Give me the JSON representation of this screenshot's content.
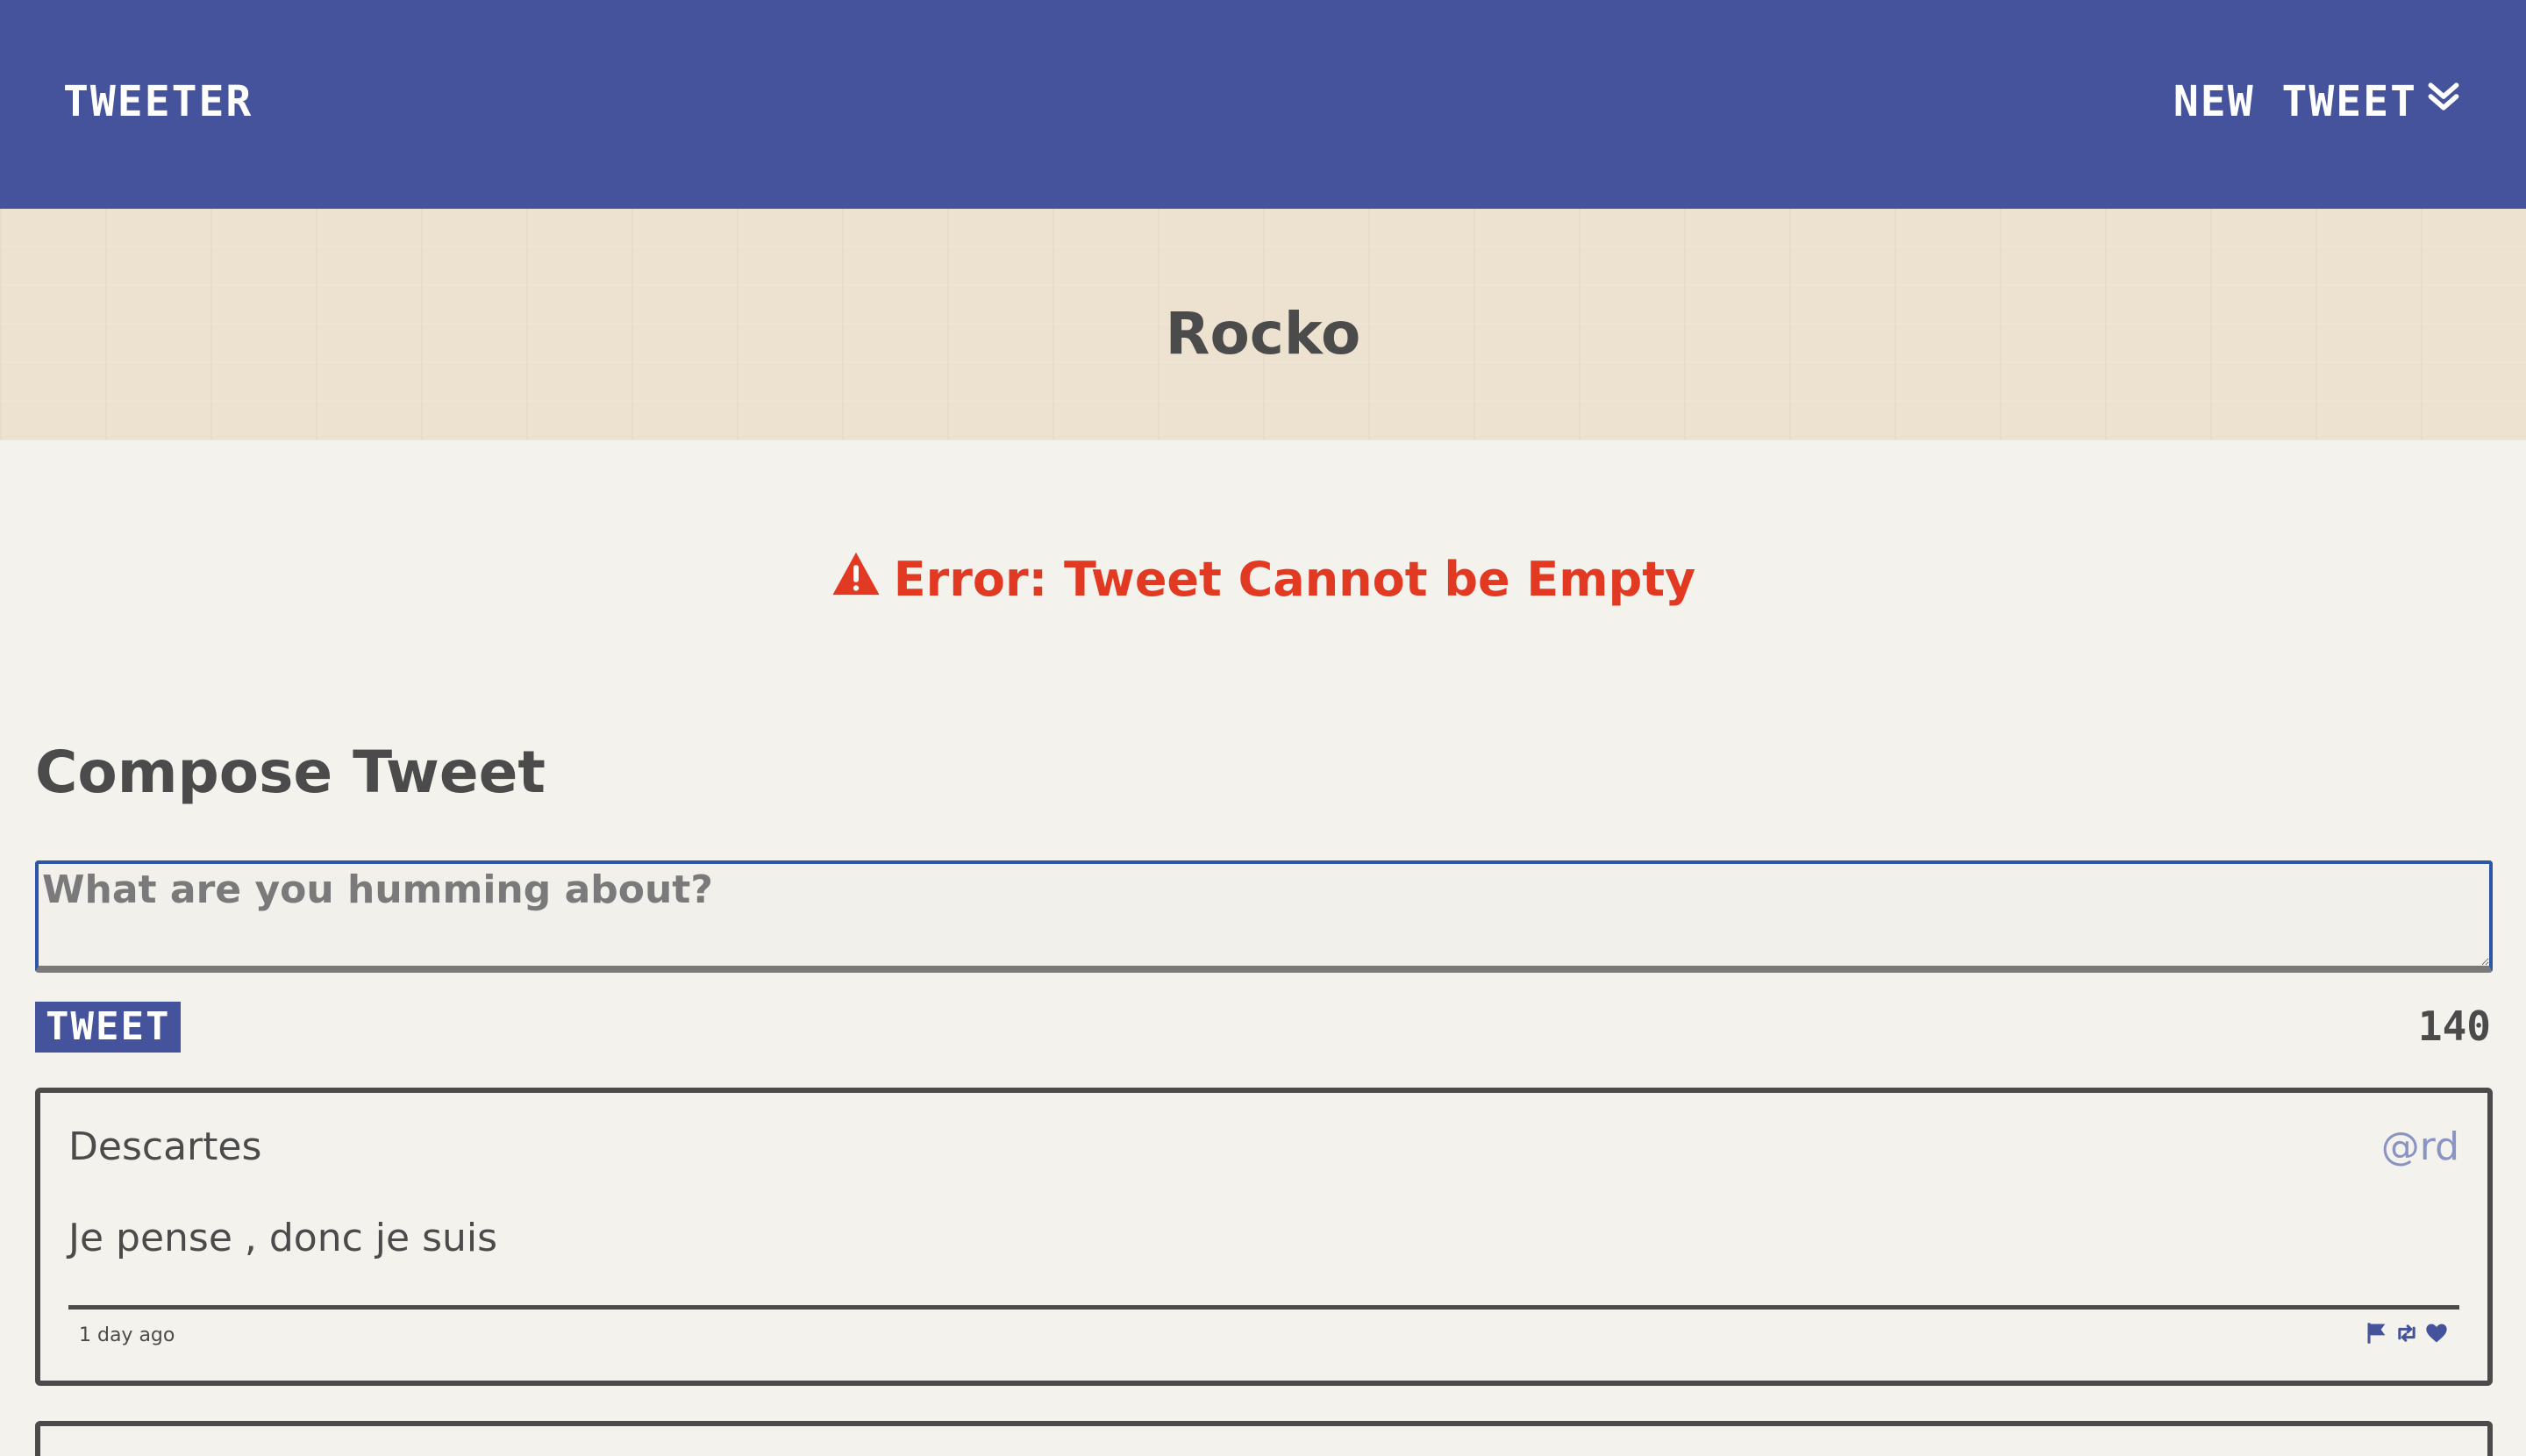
{
  "nav": {
    "brand": "TWEETER",
    "new_tweet_label": "NEW TWEET",
    "new_tweet_icon": "double-chevron-down-icon",
    "background_color": "#44539b"
  },
  "profile": {
    "name": "Rocko"
  },
  "error": {
    "icon": "warning-triangle-icon",
    "message": "Error: Tweet Cannot be Empty",
    "color": "#e23a22"
  },
  "compose": {
    "title": "Compose Tweet",
    "placeholder": "What are you humming about?",
    "value": "",
    "submit_label": "TWEET",
    "char_counter": "140"
  },
  "tweets": [
    {
      "author": "Descartes",
      "handle": "@rd",
      "text": "Je pense , donc je suis",
      "time": "1 day ago",
      "actions": [
        "flag-icon",
        "retweet-icon",
        "heart-icon"
      ]
    }
  ]
}
